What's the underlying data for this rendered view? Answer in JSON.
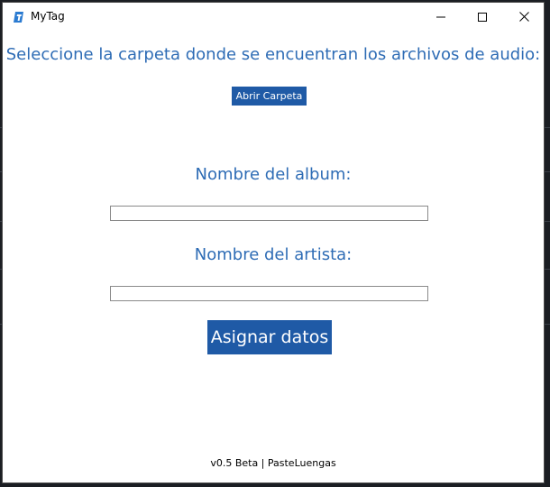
{
  "window": {
    "title": "MyTag"
  },
  "main": {
    "heading": "Seleccione la carpeta donde se encuentran los archivos de audio:",
    "open_folder_label": "Abrir Carpeta",
    "album_label": "Nombre del album:",
    "album_value": "",
    "artist_label": "Nombre del artista:",
    "artist_value": "",
    "assign_label": "Asignar datos"
  },
  "footer": {
    "version": "v0.5 Beta | PasteLuengas"
  },
  "colors": {
    "accent_text": "#2e6cb5",
    "button_bg": "#1f5aa6",
    "button_text": "#ffffff"
  },
  "icons": {
    "app": "mytag-app-icon",
    "minimize": "minimize-icon",
    "maximize": "maximize-icon",
    "close": "close-icon"
  }
}
